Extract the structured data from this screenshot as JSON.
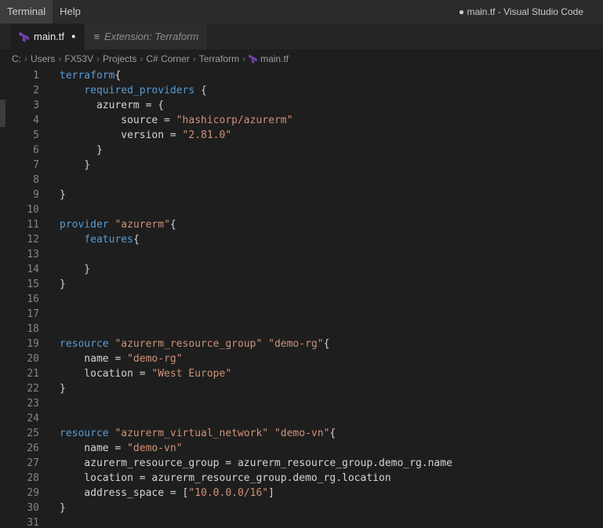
{
  "window": {
    "title": "● main.tf - Visual Studio Code",
    "menus": [
      "Terminal",
      "Help"
    ]
  },
  "tabs": [
    {
      "label": "main.tf",
      "dot": "●",
      "active": true
    },
    {
      "label": "Extension: Terraform",
      "active": false
    }
  ],
  "icons": {
    "terraform_file": "terraform-logo",
    "extension_glyph": "≡",
    "modified_dot": "●"
  },
  "breadcrumb": {
    "separator": "›",
    "items": [
      "C:",
      "Users",
      "FX53V",
      "Projects",
      "C# Corner",
      "Terraform",
      "main.tf"
    ]
  },
  "colors": {
    "keyword": "#569cd6",
    "string": "#ce9178",
    "text": "#d4d4d4",
    "editor_bg": "#1e1e1e",
    "titlebar_bg": "#2b2b2b",
    "tabbar_bg": "#252526",
    "inactive_tab_bg": "#2d2d2d",
    "line_number": "#858585",
    "terraform_purple": "#7b42bc"
  },
  "editor": {
    "language": "terraform",
    "lines": [
      {
        "num": "1",
        "tokens": [
          [
            "kw",
            "terraform"
          ],
          [
            "pl",
            "{"
          ]
        ]
      },
      {
        "num": "2",
        "tokens": [
          [
            "pl",
            "    "
          ],
          [
            "kw",
            "required_providers"
          ],
          [
            "pl",
            " {"
          ]
        ]
      },
      {
        "num": "3",
        "tokens": [
          [
            "pl",
            "      azurerm = {"
          ]
        ]
      },
      {
        "num": "4",
        "tokens": [
          [
            "pl",
            "          source = "
          ],
          [
            "str",
            "\"hashicorp/azurerm\""
          ]
        ]
      },
      {
        "num": "5",
        "tokens": [
          [
            "pl",
            "          version = "
          ],
          [
            "str",
            "\"2.81.0\""
          ]
        ]
      },
      {
        "num": "6",
        "tokens": [
          [
            "pl",
            "      }"
          ]
        ]
      },
      {
        "num": "7",
        "tokens": [
          [
            "pl",
            "    }"
          ]
        ]
      },
      {
        "num": "8",
        "tokens": []
      },
      {
        "num": "9",
        "tokens": [
          [
            "pl",
            "}"
          ]
        ]
      },
      {
        "num": "10",
        "tokens": []
      },
      {
        "num": "11",
        "tokens": [
          [
            "kw",
            "provider"
          ],
          [
            "pl",
            " "
          ],
          [
            "str",
            "\"azurerm\""
          ],
          [
            "pl",
            "{"
          ]
        ]
      },
      {
        "num": "12",
        "tokens": [
          [
            "pl",
            "    "
          ],
          [
            "kw",
            "features"
          ],
          [
            "pl",
            "{"
          ]
        ]
      },
      {
        "num": "13",
        "tokens": []
      },
      {
        "num": "14",
        "tokens": [
          [
            "pl",
            "    }"
          ]
        ]
      },
      {
        "num": "15",
        "tokens": [
          [
            "pl",
            "}"
          ]
        ]
      },
      {
        "num": "16",
        "tokens": []
      },
      {
        "num": "17",
        "tokens": []
      },
      {
        "num": "18",
        "tokens": []
      },
      {
        "num": "19",
        "tokens": [
          [
            "kw",
            "resource"
          ],
          [
            "pl",
            " "
          ],
          [
            "str",
            "\"azurerm_resource_group\""
          ],
          [
            "pl",
            " "
          ],
          [
            "str",
            "\"demo-rg\""
          ],
          [
            "pl",
            "{"
          ]
        ]
      },
      {
        "num": "20",
        "tokens": [
          [
            "pl",
            "    name = "
          ],
          [
            "str",
            "\"demo-rg\""
          ]
        ]
      },
      {
        "num": "21",
        "tokens": [
          [
            "pl",
            "    location = "
          ],
          [
            "str",
            "\"West Europe\""
          ]
        ]
      },
      {
        "num": "22",
        "tokens": [
          [
            "pl",
            "}"
          ]
        ]
      },
      {
        "num": "23",
        "tokens": []
      },
      {
        "num": "24",
        "tokens": []
      },
      {
        "num": "25",
        "tokens": [
          [
            "kw",
            "resource"
          ],
          [
            "pl",
            " "
          ],
          [
            "str",
            "\"azurerm_virtual_network\""
          ],
          [
            "pl",
            " "
          ],
          [
            "str",
            "\"demo-vn\""
          ],
          [
            "pl",
            "{"
          ]
        ]
      },
      {
        "num": "26",
        "tokens": [
          [
            "pl",
            "    name = "
          ],
          [
            "str",
            "\"demo-vn\""
          ]
        ]
      },
      {
        "num": "27",
        "tokens": [
          [
            "pl",
            "    azurerm_resource_group = azurerm_resource_group.demo_rg.name"
          ]
        ]
      },
      {
        "num": "28",
        "tokens": [
          [
            "pl",
            "    location = azurerm_resource_group.demo_rg.location"
          ]
        ]
      },
      {
        "num": "29",
        "tokens": [
          [
            "pl",
            "    address_space = ["
          ],
          [
            "str",
            "\"10.0.0.0/16\""
          ],
          [
            "pl",
            "]"
          ]
        ]
      },
      {
        "num": "30",
        "tokens": [
          [
            "pl",
            "}"
          ]
        ]
      },
      {
        "num": "31",
        "tokens": []
      }
    ]
  }
}
